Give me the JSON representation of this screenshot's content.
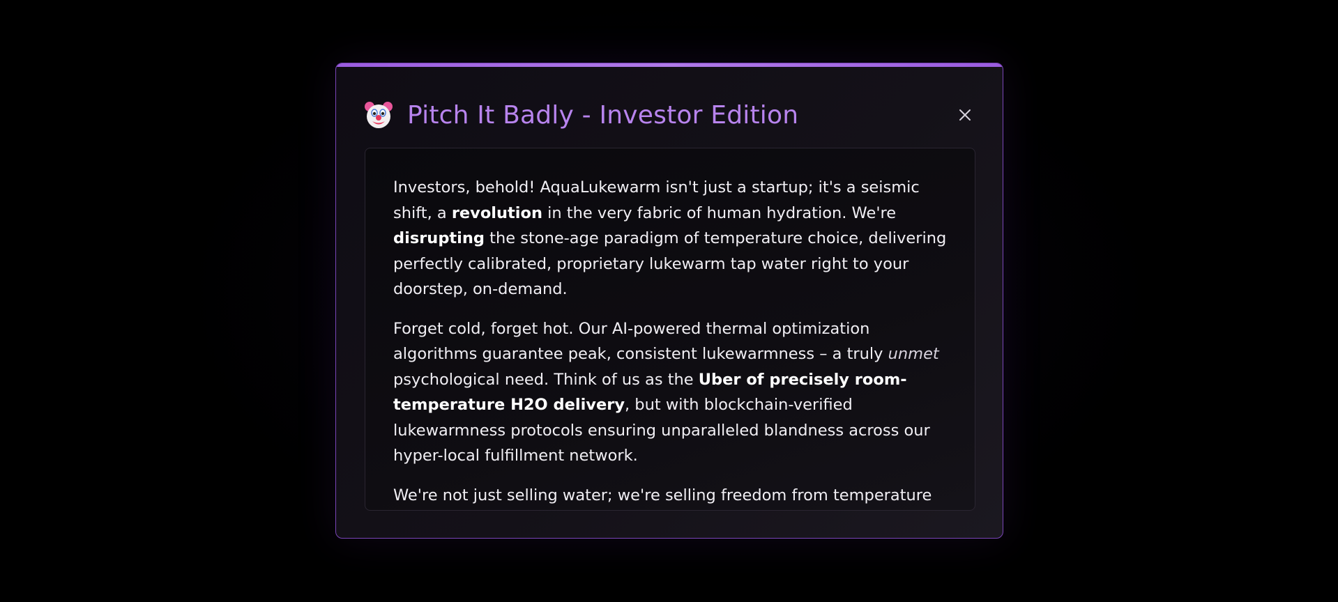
{
  "modal": {
    "icon": "clown-face-icon",
    "title": "Pitch It Badly - Investor Edition",
    "close_icon": "close-icon",
    "accent_color": "#b884ee"
  },
  "pitch": {
    "p1_a": "Investors, behold! AquaLukewarm isn't just a startup; it's a seismic shift, a ",
    "p1_b": "revolution",
    "p1_c": " in the very fabric of human hydration. We're ",
    "p1_d": "disrupting",
    "p1_e": " the stone-age paradigm of temperature choice, delivering perfectly calibrated, proprietary lukewarm tap water right to your doorstep, on-demand.",
    "p2_a": "Forget cold, forget hot. Our AI-powered thermal optimization algorithms guarantee peak, consistent lukewarmness – a truly ",
    "p2_b": "unmet",
    "p2_c": " psychological need. Think of us as the ",
    "p2_d": "Uber of precisely room-temperature H2O delivery",
    "p2_e": ", but with blockchain-verified lukewarmness protocols ensuring unparalleled blandness across our hyper-local fulfillment network.",
    "p3": "We're not just selling water; we're selling freedom from temperature"
  }
}
